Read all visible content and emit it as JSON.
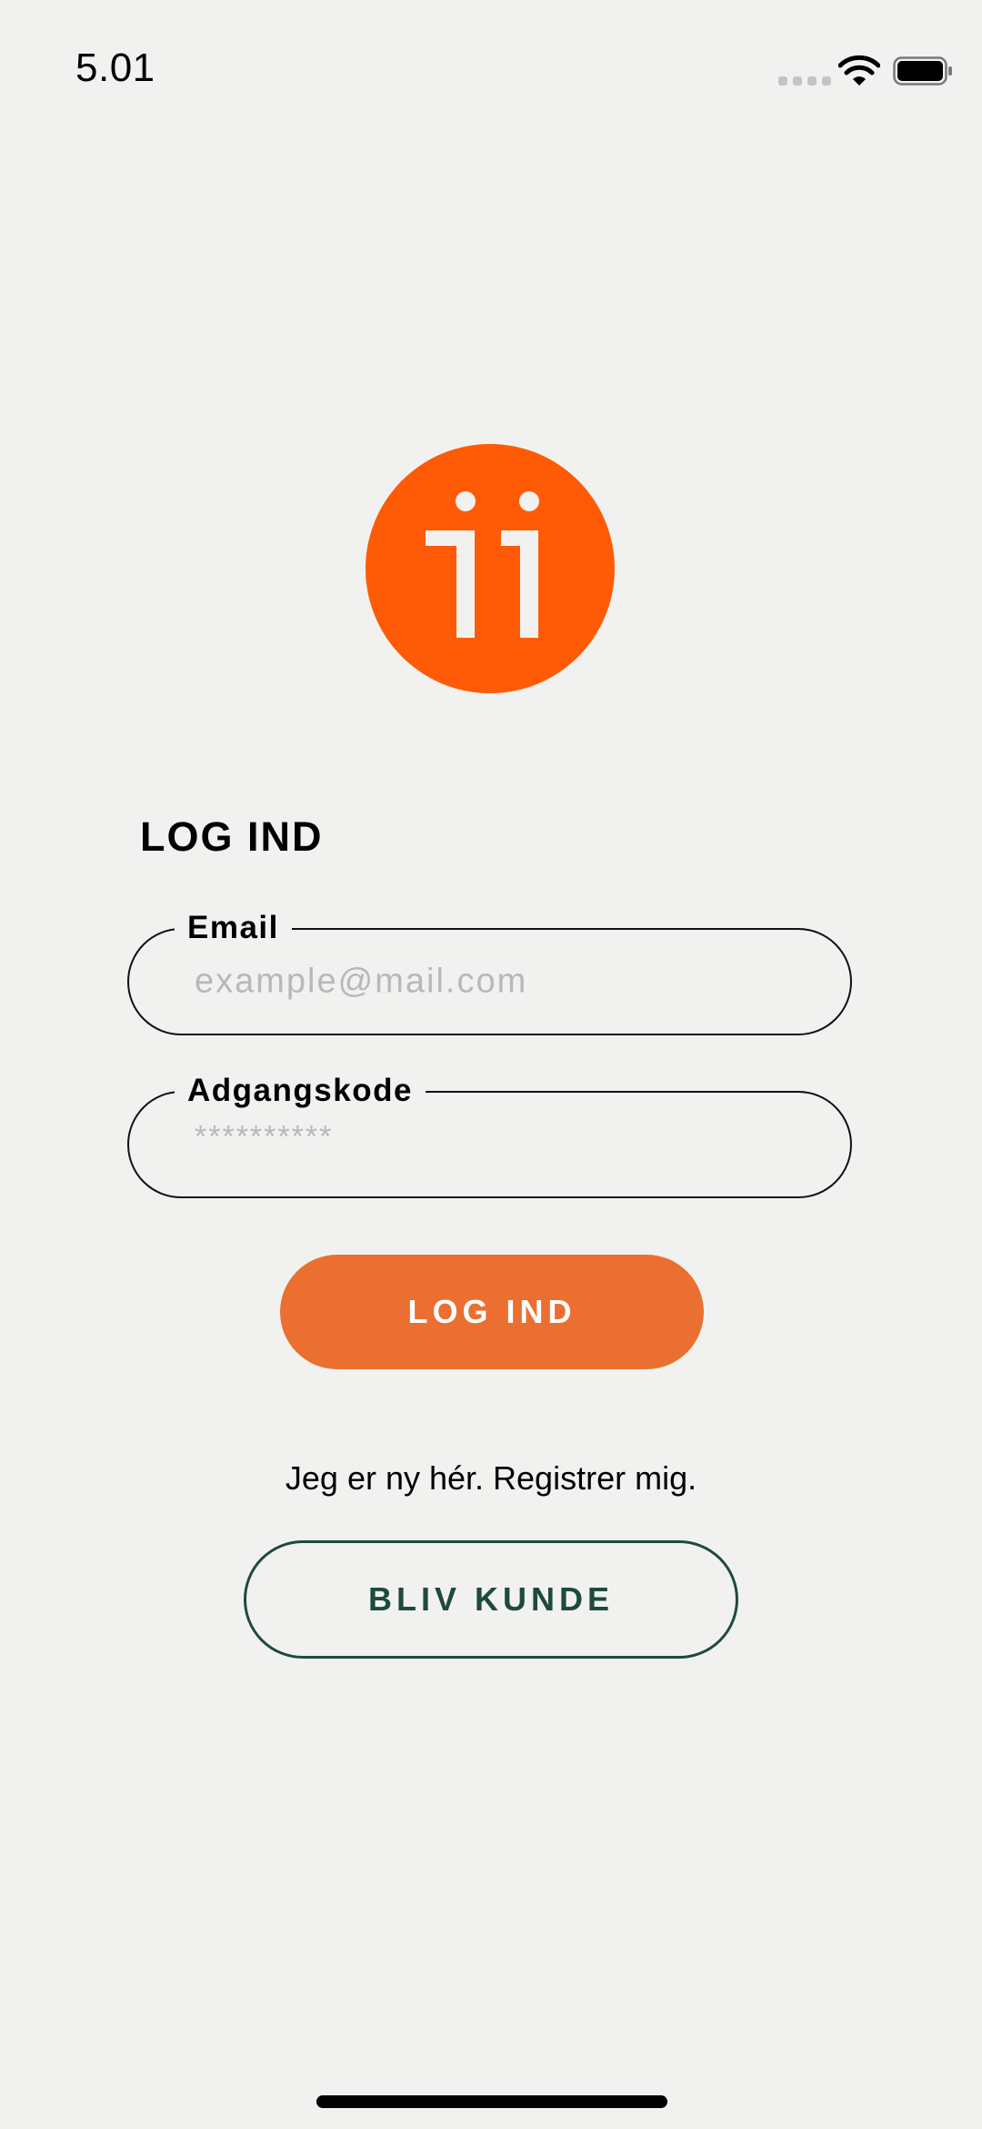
{
  "status_bar": {
    "time": "5.01",
    "icons": [
      "cellular-signal-icon",
      "wifi-icon",
      "battery-icon"
    ]
  },
  "logo": {
    "icon": "app-logo",
    "color": "#ff5a05"
  },
  "login_form": {
    "heading": "LOG IND",
    "email": {
      "label": "Email",
      "placeholder": "example@mail.com",
      "value": ""
    },
    "password": {
      "label": "Adgangskode",
      "placeholder": "**********",
      "value": ""
    },
    "submit_label": "LOG IND"
  },
  "register": {
    "prompt": "Jeg er ny hér. Registrer mig.",
    "button_label": "BLIV KUNDE"
  },
  "colors": {
    "background": "#f1f2f0",
    "primary_button": "#eb6f30",
    "secondary_button_border": "#1e4a3c",
    "logo": "#ff5a05"
  }
}
